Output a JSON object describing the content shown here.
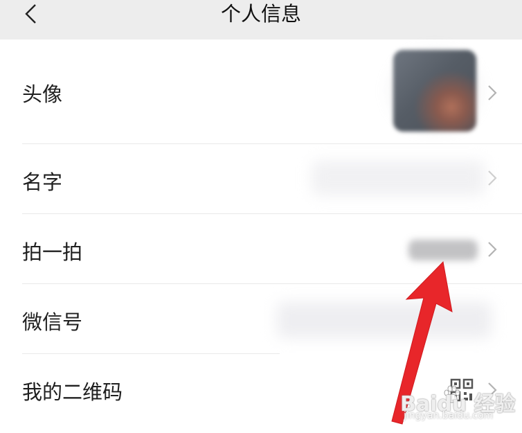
{
  "header": {
    "title": "个人信息"
  },
  "rows": [
    {
      "label": "头像"
    },
    {
      "label": "名字"
    },
    {
      "label": "拍一拍"
    },
    {
      "label": "微信号"
    },
    {
      "label": "我的二维码"
    }
  ],
  "watermark": {
    "brand": "Baidu 经验",
    "url": "jingyan.baidu.com"
  },
  "colors": {
    "header_bg": "#ededed",
    "arrow": "#e8262a",
    "chevron": "#b3b3b3"
  }
}
